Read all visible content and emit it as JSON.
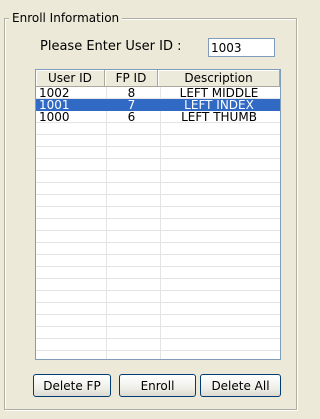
{
  "group": {
    "title": "Enroll Information"
  },
  "prompt": {
    "label": "Please Enter User ID :",
    "user_id_value": "1003"
  },
  "table": {
    "columns": [
      "User ID",
      "FP ID",
      "Description"
    ],
    "rows": [
      {
        "user_id": "1002",
        "fp_id": "8",
        "description": "LEFT MIDDLE",
        "selected": false
      },
      {
        "user_id": "1001",
        "fp_id": "7",
        "description": "LEFT INDEX",
        "selected": true
      },
      {
        "user_id": "1000",
        "fp_id": "6",
        "description": "LEFT THUMB",
        "selected": false
      }
    ],
    "selection_color": "#316ac5"
  },
  "buttons": {
    "delete_fp": "Delete FP",
    "enroll": "Enroll",
    "delete_all": "Delete All"
  }
}
